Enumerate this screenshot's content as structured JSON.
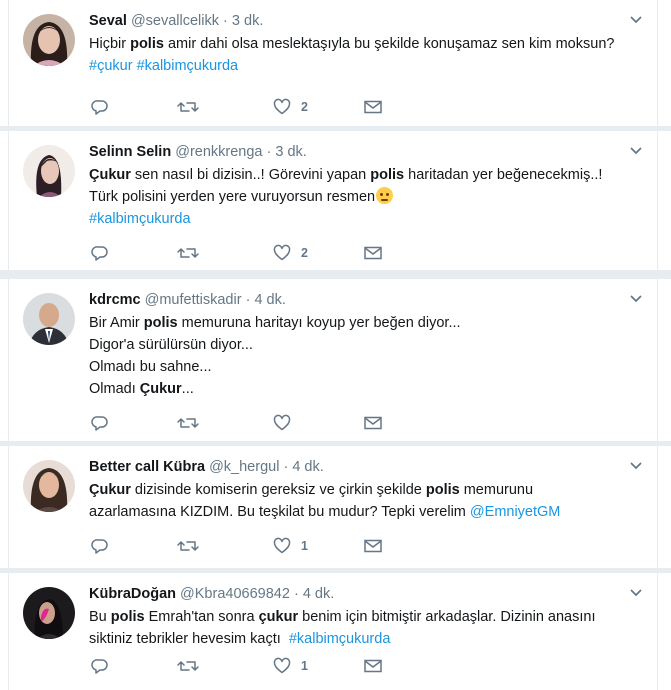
{
  "colors": {
    "link": "#1b95e0",
    "muted": "#657786",
    "separator": "#e6ecf0",
    "text": "#14171a"
  },
  "tweets": [
    {
      "name": "Seval",
      "handle": "@sevallcelikk",
      "dot": "·",
      "time": "3 dk.",
      "text": {
        "l1a": "Hiçbir ",
        "l1b": "polis",
        "l1c": " amir dahi olsa meslektaşıyla bu şekilde konuşamaz sen kim moksun?",
        "tag1": "#çukur",
        "tag2": "#kalbimçukurda"
      },
      "likes": "2",
      "retweets": ""
    },
    {
      "name": "Selinn Selin",
      "handle": "@renkkrenga",
      "dot": "·",
      "time": "3 dk.",
      "text": {
        "l1a": "Çukur",
        "l1b": " sen nasıl bi dizisin..! Görevini yapan ",
        "l1c": "polis",
        "l1d": " haritadan yer beğenecekmiş..!",
        "l2": "Türk polisini yerden yere vuruyorsun resmen",
        "tag": "#kalbimçukurda"
      },
      "likes": "2"
    },
    {
      "name": "kdrcmc",
      "handle": "@mufettiskadir",
      "dot": "·",
      "time": "4 dk.",
      "text": {
        "l1a": "Bir Amir ",
        "l1b": "polis",
        "l1c": " memuruna haritayı koyup yer beğen diyor...",
        "l2": "Digor'a sürülürsün diyor...",
        "l3": "Olmadı bu sahne...",
        "l4a": "Olmadı ",
        "l4b": "Çukur",
        "l4c": "..."
      },
      "likes": ""
    },
    {
      "name": "Better call Kübra",
      "handle": "@k_hergul",
      "dot": "·",
      "time": "4 dk.",
      "text": {
        "l1a": "Çukur",
        "l1b": " dizisinde komiserin gereksiz ve çirkin şekilde ",
        "l1c": "polis",
        "l1d": " memurunu",
        "l2": "azarlamasına KIZDIM. Bu teşkilat bu mudur? Tepki verelim ",
        "mention": "@EmniyetGM"
      },
      "likes": "1"
    },
    {
      "name": "KübraDoğan",
      "handle": "@Kbra40669842",
      "dot": "·",
      "time": "4 dk.",
      "text": {
        "l1a": "Bu ",
        "l1b": "polis",
        "l1c": " Emrah'tan sonra ",
        "l1d": "çukur",
        "l1e": " benim için bitmiştir arkadaşlar. Dizinin anasını",
        "l2": "siktiniz tebrikler hevesim kaçtı  ",
        "tag": "#kalbimçukurda"
      },
      "likes": "1"
    }
  ],
  "icons": {
    "reply": "reply-icon",
    "retweet": "retweet-icon",
    "like": "heart-icon",
    "dm": "envelope-icon",
    "caret": "chevron-down-icon",
    "emoji": "angry-face-emoji"
  }
}
